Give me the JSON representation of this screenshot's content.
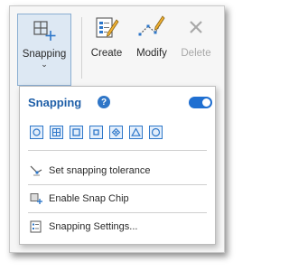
{
  "ribbon": {
    "snapping_label": "Snapping",
    "create_label": "Create",
    "modify_label": "Modify",
    "delete_label": "Delete"
  },
  "panel": {
    "title": "Snapping",
    "help_icon_glyph": "?",
    "toggle_on": true,
    "snap_modes": [
      {
        "icon": "point-snap-icon"
      },
      {
        "icon": "vertex-snap-icon"
      },
      {
        "icon": "edge-snap-icon"
      },
      {
        "icon": "end-snap-icon"
      },
      {
        "icon": "intersection-snap-icon"
      },
      {
        "icon": "midpoint-snap-icon"
      },
      {
        "icon": "tangent-snap-icon"
      }
    ],
    "menu": {
      "tolerance": "Set snapping tolerance",
      "snap_chip": "Enable Snap Chip",
      "settings": "Snapping Settings..."
    }
  },
  "colors": {
    "accent": "#1f6fd1",
    "title": "#1f5fa8",
    "disabled": "#a8a8a8"
  }
}
